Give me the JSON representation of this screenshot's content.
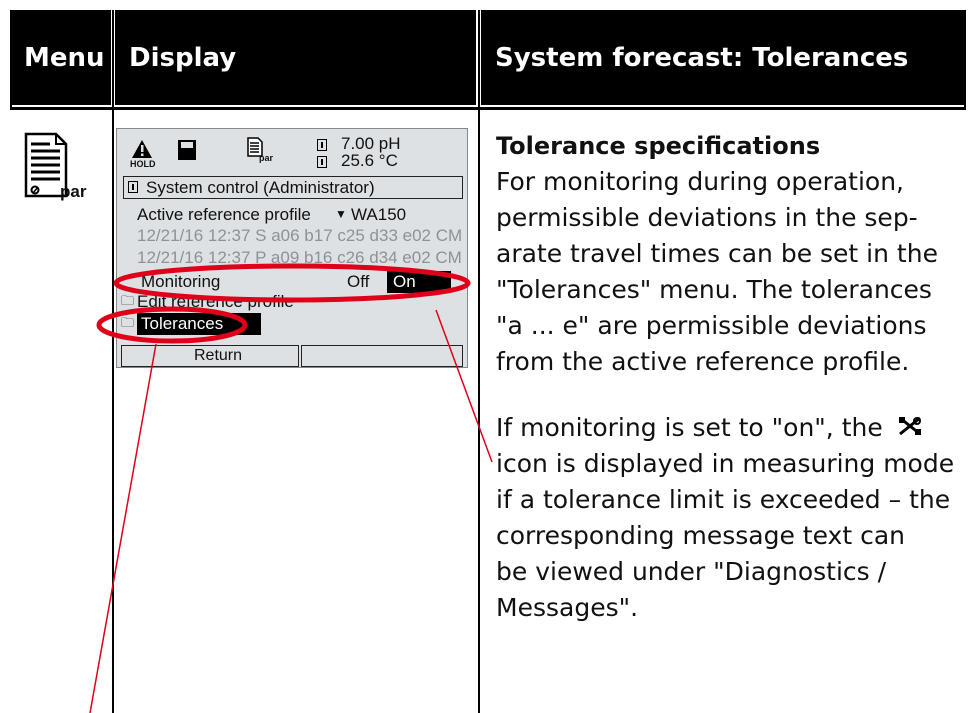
{
  "header": {
    "menu": "Menu",
    "display": "Display",
    "section": "System forecast: Tolerances"
  },
  "menu_icon": {
    "label": "par"
  },
  "lcd": {
    "hold": "HOLD",
    "par": "par",
    "ph_value": "7.00 pH",
    "temp_value": "25.6 °C",
    "title": "System control (Administrator)",
    "profile_label": "Active reference profile",
    "profile_value": "WA150",
    "line_s": "12/21/16 12:37  S  a06 b17 c25 d33 e02 CM",
    "line_p": "12/21/16 12:37  P  a09 b16 c26 d34 e02 CM",
    "monitoring_label": "Monitoring",
    "off": "Off",
    "on": "On",
    "edit_profile": "Edit reference profile",
    "tolerances": "Tolerances",
    "return": "Return"
  },
  "content": {
    "heading": "Tolerance specifications",
    "para1": [
      "For monitoring during operation,",
      "permissible deviations in the sep-",
      "arate travel times can be set in the",
      "\"Tolerances\" menu. The tolerances",
      "\"a ... e\" are permissible deviations",
      "from the active reference profile."
    ],
    "para2_first": "If monitoring is set to \"on\", the",
    "para2_rest": [
      "icon is displayed in measuring mode",
      "if a tolerance limit is exceeded – the",
      "corresponding message text can",
      "be viewed under \"Diagnostics /",
      "Messages\"."
    ]
  },
  "colors": {
    "highlight": "#e1001a",
    "header_bg": "#000000",
    "lcd_bg": "#dde1e4"
  }
}
